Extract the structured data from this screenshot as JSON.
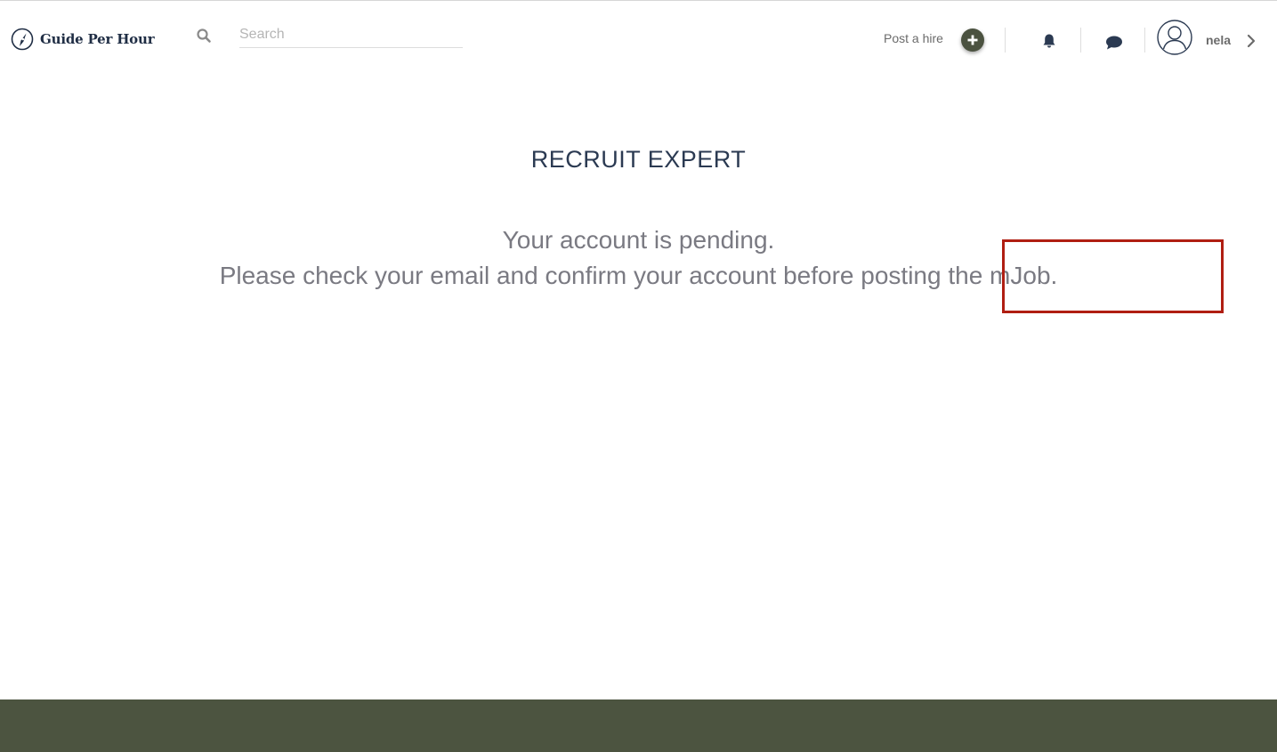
{
  "header": {
    "logo_text": "Guide Per Hour",
    "search_placeholder": "Search",
    "post_hire_label": "Post a hire",
    "username": "nela"
  },
  "main": {
    "title": "RECRUIT EXPERT",
    "message_line1": "Your account is pending.",
    "message_line2": "Please check your email and confirm your account before posting the mJob."
  },
  "icons": {
    "logo": "compass-logo-icon",
    "search": "search-icon",
    "add": "plus-icon",
    "notifications": "bell-icon",
    "messages": "chat-bubble-icon",
    "avatar": "user-avatar-icon",
    "expand": "chevron-right-icon"
  },
  "colors": {
    "brand_navy": "#1f2d44",
    "accent_olive": "#4b5240",
    "footer_bg": "#4c5440",
    "message_gray": "#7a7a82",
    "highlight_red": "#b01e12"
  }
}
